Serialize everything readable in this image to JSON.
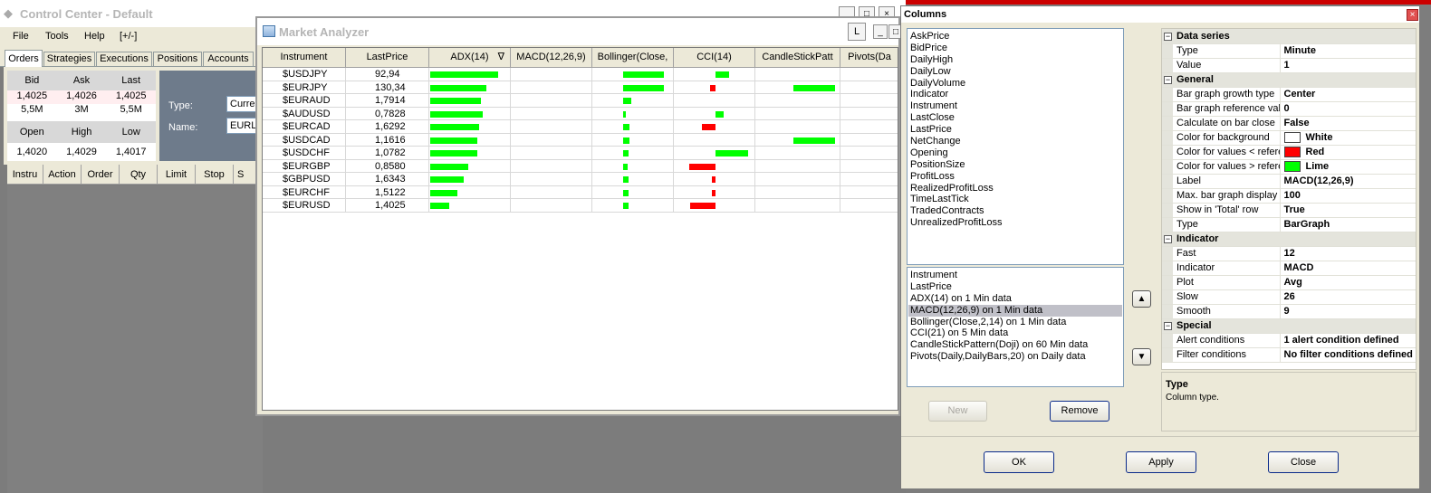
{
  "control_center": {
    "title": "Control Center - Default",
    "menu": [
      "File",
      "Tools",
      "Help",
      "[+/-]"
    ],
    "tabs": [
      "Orders",
      "Strategies",
      "Executions",
      "Positions",
      "Accounts"
    ],
    "quote": {
      "headers": [
        "Bid",
        "Ask",
        "Last"
      ],
      "values": [
        "1,4025",
        "1,4026",
        "1,4025"
      ],
      "sizes": [
        "5,5M",
        "3M",
        "5,5M"
      ],
      "headers2": [
        "Open",
        "High",
        "Low"
      ],
      "values2": [
        "1,4020",
        "1,4029",
        "1,4017"
      ]
    },
    "type_label": "Type:",
    "type_value": "Curre",
    "name_label": "Name:",
    "name_value": "EURL",
    "order_cols": [
      "Instru",
      "Action",
      "Order",
      "Qty",
      "Limit",
      "Stop",
      "S"
    ]
  },
  "market_analyzer": {
    "title": "Market Analyzer",
    "btn_l": "L",
    "btn_min": "_",
    "btn_max": "□",
    "btn_close": "×",
    "columns": [
      "Instrument",
      "LastPrice",
      "ADX(14)",
      "MACD(12,26,9)",
      "Bollinger(Close,",
      "CCI(14)",
      "CandleStickPatt",
      "Pivots(Da"
    ],
    "sort_indicator": "∇",
    "rows": [
      {
        "instrument": "$USDJPY",
        "last": "92,94",
        "adx": 0.82,
        "boll": 0.98,
        "cci": 0.3,
        "cci_color": "#00ff00",
        "candle": 0
      },
      {
        "instrument": "$EURJPY",
        "last": "130,34",
        "adx": 0.67,
        "boll": 0.98,
        "cci": -0.12,
        "cci_color": "#ff0000",
        "candle": 0.92
      },
      {
        "instrument": "$EURAUD",
        "last": "1,7914",
        "adx": 0.61,
        "boll": 0.2,
        "cci": 0,
        "cci_color": "#00ff00",
        "candle": 0
      },
      {
        "instrument": "$AUDUSD",
        "last": "0,7828",
        "adx": 0.63,
        "boll": 0.06,
        "cci": 0.18,
        "cci_color": "#00ff00",
        "candle": 0
      },
      {
        "instrument": "$EURCAD",
        "last": "1,6292",
        "adx": 0.59,
        "boll": 0.16,
        "cci": -0.3,
        "cci_color": "#ff0000",
        "candle": 0
      },
      {
        "instrument": "$USDCAD",
        "last": "1,1616",
        "adx": 0.56,
        "boll": 0.16,
        "cci": 0,
        "cci_color": "#00ff00",
        "candle": 0.92
      },
      {
        "instrument": "$USDCHF",
        "last": "1,0782",
        "adx": 0.56,
        "boll": 0.14,
        "cci": 0.72,
        "cci_color": "#00ff00",
        "candle": 0
      },
      {
        "instrument": "$EURGBP",
        "last": "0,8580",
        "adx": 0.46,
        "boll": 0.1,
        "cci": -0.58,
        "cci_color": "#ff0000",
        "candle": 0
      },
      {
        "instrument": "$GBPUSD",
        "last": "1,6343",
        "adx": 0.4,
        "boll": 0.12,
        "cci": -0.06,
        "cci_color": "#ff0000",
        "candle": 0
      },
      {
        "instrument": "$EURCHF",
        "last": "1,5122",
        "adx": 0.33,
        "boll": 0.12,
        "cci": -0.06,
        "cci_color": "#ff0000",
        "candle": 0
      },
      {
        "instrument": "$EURUSD",
        "last": "1,4025",
        "adx": 0.23,
        "boll": 0.12,
        "cci": -0.56,
        "cci_color": "#ff0000",
        "candle": 0
      }
    ]
  },
  "columns_dialog": {
    "title": "Columns",
    "available": [
      "AskPrice",
      "BidPrice",
      "DailyHigh",
      "DailyLow",
      "DailyVolume",
      "Indicator",
      "Instrument",
      "LastClose",
      "LastPrice",
      "NetChange",
      "Opening",
      "PositionSize",
      "ProfitLoss",
      "RealizedProfitLoss",
      "TimeLastTick",
      "TradedContracts",
      "UnrealizedProfitLoss"
    ],
    "selected": [
      "Instrument",
      "LastPrice",
      "ADX(14) on 1 Min data",
      "MACD(12,26,9) on 1 Min data",
      "Bollinger(Close,2,14) on 1 Min data",
      "CCI(21) on 5 Min data",
      "CandleStickPattern(Doji) on 60 Min data",
      "Pivots(Daily,DailyBars,20) on Daily data"
    ],
    "selected_index": 3,
    "up_icon": "▲",
    "down_icon": "▼",
    "new_label": "New",
    "remove_label": "Remove",
    "ok_label": "OK",
    "apply_label": "Apply",
    "close_label": "Close",
    "properties": [
      {
        "category": "Data series",
        "rows": [
          {
            "name": "Type",
            "value": "Minute"
          },
          {
            "name": "Value",
            "value": "1"
          }
        ]
      },
      {
        "category": "General",
        "rows": [
          {
            "name": "Bar graph growth type",
            "value": "Center"
          },
          {
            "name": "Bar graph reference valu",
            "value": "0"
          },
          {
            "name": "Calculate on bar close",
            "value": "False"
          },
          {
            "name": "Color for background",
            "value": "White",
            "swatch": "#ffffff"
          },
          {
            "name": "Color for values < referer",
            "value": "Red",
            "swatch": "#ff0000"
          },
          {
            "name": "Color for values > referer",
            "value": "Lime",
            "swatch": "#00ff00"
          },
          {
            "name": "Label",
            "value": "MACD(12,26,9)"
          },
          {
            "name": "Max. bar graph display v",
            "value": "100"
          },
          {
            "name": "Show in 'Total' row",
            "value": "True"
          },
          {
            "name": "Type",
            "value": "BarGraph"
          }
        ]
      },
      {
        "category": "Indicator",
        "rows": [
          {
            "name": "Fast",
            "value": "12"
          },
          {
            "name": "Indicator",
            "value": "MACD"
          },
          {
            "name": "Plot",
            "value": "Avg"
          },
          {
            "name": "Slow",
            "value": "26"
          },
          {
            "name": "Smooth",
            "value": "9"
          }
        ]
      },
      {
        "category": "Special",
        "rows": [
          {
            "name": "Alert conditions",
            "value": "1 alert condition defined"
          },
          {
            "name": "Filter conditions",
            "value": "No filter conditions defined"
          }
        ]
      }
    ],
    "help_title": "Type",
    "help_text": "Column type."
  },
  "colors": {
    "lime": "#00ff00",
    "red": "#ff0000",
    "selection": "#c0c0c8"
  }
}
